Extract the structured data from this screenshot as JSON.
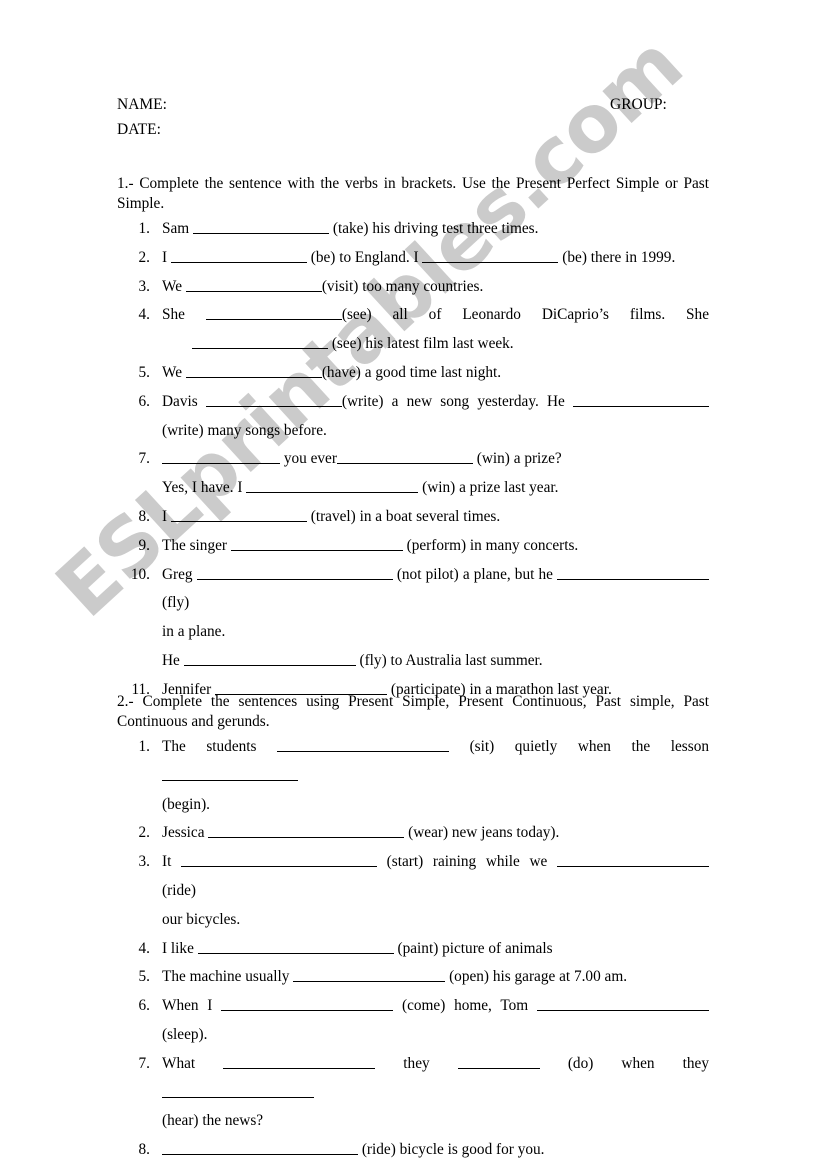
{
  "document": {
    "type": "esl-grammar-worksheet",
    "watermark": "ESLprintables.com"
  },
  "header": {
    "name_label": "NAME:",
    "date_label": "DATE:",
    "group_label": "GROUP:"
  },
  "exercise1": {
    "heading": "1.- Complete the sentence with the verbs in brackets. Use the Present Perfect Simple or Past Simple.",
    "items": [
      {
        "number": "1.",
        "lines": [
          {
            "segments": [
              {
                "text": "Sam "
              },
              {
                "blank": "b-xl"
              },
              {
                "text": " (take) his driving test three times."
              }
            ]
          }
        ]
      },
      {
        "number": "2.",
        "lines": [
          {
            "segments": [
              {
                "text": "I "
              },
              {
                "blank": "b-xl"
              },
              {
                "text": " (be) to England. I "
              },
              {
                "blank": "b-xl"
              },
              {
                "text": " (be) there in 1999."
              }
            ]
          }
        ]
      },
      {
        "number": "3.",
        "lines": [
          {
            "segments": [
              {
                "text": "We "
              },
              {
                "blank": "b-xl"
              },
              {
                "text": "(visit) too many countries."
              }
            ]
          }
        ]
      },
      {
        "number": "4.",
        "justify_first": true,
        "lines": [
          {
            "segments": [
              {
                "text": "She "
              },
              {
                "blank": "b-xl"
              },
              {
                "text": "(see) all of Leonardo DiCaprio’s films. She"
              }
            ]
          },
          {
            "indent": 30,
            "segments": [
              {
                "blank": "b-xl"
              },
              {
                "text": " (see) his latest film last week."
              }
            ]
          }
        ]
      },
      {
        "number": "5.",
        "lines": [
          {
            "segments": [
              {
                "text": "We "
              },
              {
                "blank": "b-xl"
              },
              {
                "text": "(have) a good time last night."
              }
            ]
          }
        ]
      },
      {
        "number": "6.",
        "justify_first": true,
        "lines": [
          {
            "segments": [
              {
                "text": "Davis "
              },
              {
                "blank": "b-xl"
              },
              {
                "text": "(write) a new song yesterday. He "
              },
              {
                "blank": "b-xl"
              }
            ]
          },
          {
            "segments": [
              {
                "text": "(write) many songs before."
              }
            ]
          }
        ]
      },
      {
        "number": "7.",
        "lines": [
          {
            "segments": [
              {
                "blank": "b-lg"
              },
              {
                "text": " you ever"
              },
              {
                "blank": "b-xl"
              },
              {
                "text": " (win) a prize?"
              }
            ]
          },
          {
            "segments": [
              {
                "text": "Yes, I have. I "
              },
              {
                "blank": "b-3xl"
              },
              {
                "text": " (win) a prize last year."
              }
            ]
          }
        ]
      },
      {
        "number": "8.",
        "lines": [
          {
            "segments": [
              {
                "text": "I "
              },
              {
                "blank": "b-xl"
              },
              {
                "text": " (travel) in a boat several times."
              }
            ]
          }
        ]
      },
      {
        "number": "9.",
        "lines": [
          {
            "segments": [
              {
                "text": "The singer "
              },
              {
                "blank": "b-3xl"
              },
              {
                "text": " (perform) in many concerts."
              }
            ]
          }
        ]
      },
      {
        "number": "10.",
        "justify_first": true,
        "lines": [
          {
            "segments": [
              {
                "text": "Greg "
              },
              {
                "blank": "b-4xl"
              },
              {
                "text": " (not pilot) a plane, but he "
              },
              {
                "blank": "b-2xl"
              },
              {
                "text": " (fly)"
              }
            ]
          },
          {
            "segments": [
              {
                "text": "in a plane."
              }
            ]
          },
          {
            "segments": [
              {
                "text": "He "
              },
              {
                "blank": "b-3xl"
              },
              {
                "text": " (fly) to Australia last summer."
              }
            ]
          }
        ]
      },
      {
        "number": "11.",
        "lines": [
          {
            "segments": [
              {
                "text": "Jennifer "
              },
              {
                "blank": "b-3xl"
              },
              {
                "text": " (participate) in a marathon last year."
              }
            ]
          }
        ]
      }
    ]
  },
  "exercise2": {
    "heading": "2.- Complete the sentences using Present Simple, Present Continuous, Past simple, Past Continuous and gerunds.",
    "items": [
      {
        "number": "1.",
        "justify_first": true,
        "lines": [
          {
            "segments": [
              {
                "text": "The students "
              },
              {
                "blank": "b-3xl"
              },
              {
                "text": " (sit) quietly when the lesson "
              },
              {
                "blank": "b-xl"
              }
            ]
          },
          {
            "segments": [
              {
                "text": "(begin)."
              }
            ]
          }
        ]
      },
      {
        "number": "2.",
        "lines": [
          {
            "segments": [
              {
                "text": "Jessica "
              },
              {
                "blank": "b-4xl"
              },
              {
                "text": " (wear) new jeans today)."
              }
            ]
          }
        ]
      },
      {
        "number": "3.",
        "justify_first": true,
        "lines": [
          {
            "segments": [
              {
                "text": "It "
              },
              {
                "blank": "b-4xl"
              },
              {
                "text": " (start) raining while we "
              },
              {
                "blank": "b-2xl"
              },
              {
                "text": " (ride)"
              }
            ]
          },
          {
            "segments": [
              {
                "text": "our bicycles."
              }
            ]
          }
        ]
      },
      {
        "number": "4.",
        "lines": [
          {
            "segments": [
              {
                "text": "I like "
              },
              {
                "blank": "b-4xl"
              },
              {
                "text": " (paint) picture of animals"
              }
            ]
          }
        ]
      },
      {
        "number": "5.",
        "lines": [
          {
            "segments": [
              {
                "text": "The machine usually "
              },
              {
                "blank": "b-2xl"
              },
              {
                "text": " (open) his garage at 7.00 am."
              }
            ]
          }
        ]
      },
      {
        "number": "6.",
        "justify_first": true,
        "lines": [
          {
            "segments": [
              {
                "text": "When I "
              },
              {
                "blank": "b-3xl"
              },
              {
                "text": " (come) home, Tom "
              },
              {
                "blank": "b-3xl"
              }
            ]
          },
          {
            "segments": [
              {
                "text": "(sleep)."
              }
            ]
          }
        ]
      },
      {
        "number": "7.",
        "justify_first": true,
        "lines": [
          {
            "segments": [
              {
                "text": "What "
              },
              {
                "blank": "b-2xl"
              },
              {
                "text": " they "
              },
              {
                "blank": "b-sm"
              },
              {
                "text": " (do) when they "
              },
              {
                "blank": "b-2xl"
              }
            ]
          },
          {
            "segments": [
              {
                "text": "(hear) the news?"
              }
            ]
          }
        ]
      },
      {
        "number": "8.",
        "lines": [
          {
            "segments": [
              {
                "blank": "b-4xl"
              },
              {
                "text": " (ride) bicycle is good for you."
              }
            ]
          }
        ]
      }
    ]
  }
}
